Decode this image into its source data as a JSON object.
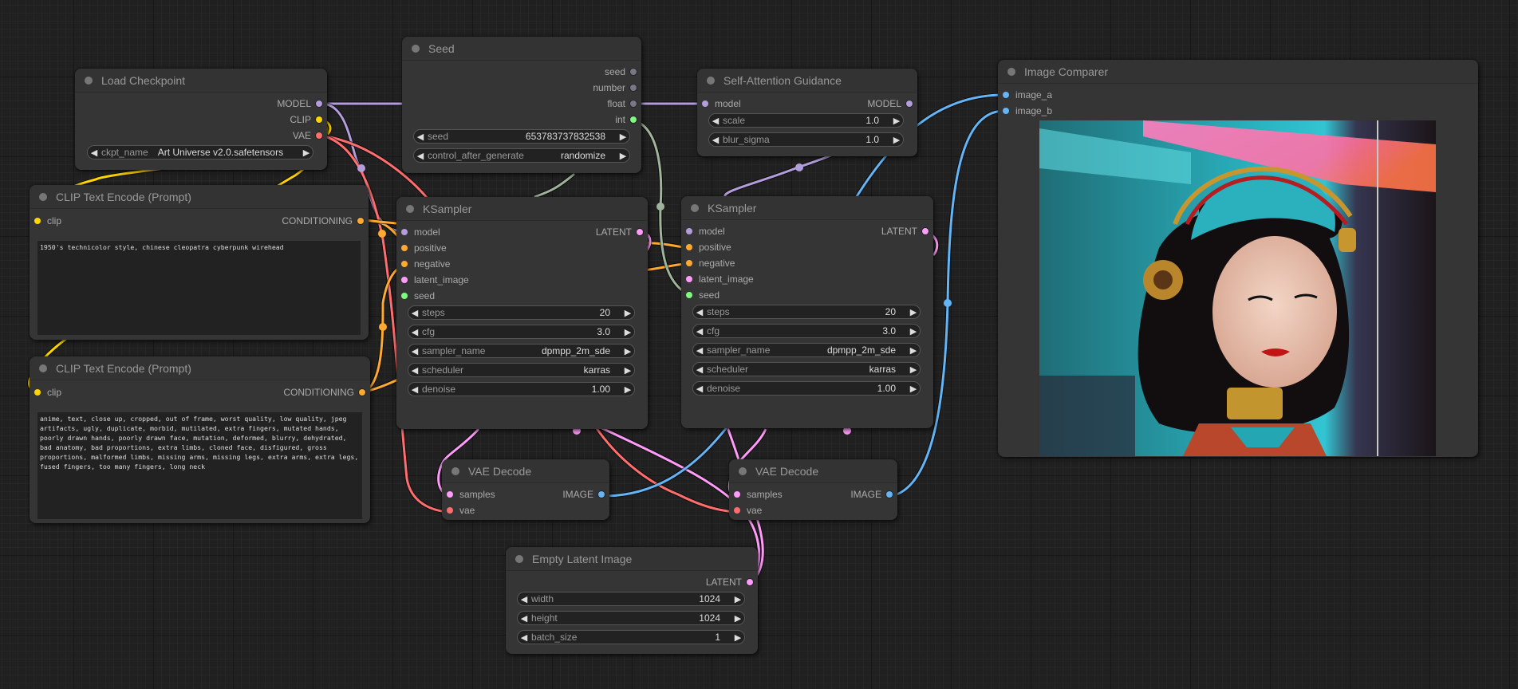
{
  "colors": {
    "MODEL": "#b39ddb",
    "CLIP": "#ffd500",
    "VAE": "#ff6e6e",
    "CONDITIONING": "#ffa931",
    "LATENT": "#ff9cf9",
    "IMAGE": "#64b5f6",
    "INT": "#7ffa7f",
    "INT_WIRE": "#a0b39b",
    "generic": "#778"
  },
  "nodes": {
    "load_checkpoint": {
      "title": "Load Checkpoint",
      "outputs": [
        "MODEL",
        "CLIP",
        "VAE"
      ],
      "widgets": [
        {
          "label": "ckpt_name",
          "value": "Art Universe v2.0.safetensors"
        }
      ]
    },
    "seed": {
      "title": "Seed",
      "outputs": [
        "seed",
        "number",
        "float",
        "int"
      ],
      "widgets": [
        {
          "label": "seed",
          "value": "653783737832538"
        },
        {
          "label": "control_after_generate",
          "value": "randomize"
        }
      ]
    },
    "sag": {
      "title": "Self-Attention Guidance",
      "inputs": [
        "model"
      ],
      "outputs": [
        "MODEL"
      ],
      "widgets": [
        {
          "label": "scale",
          "value": "1.0"
        },
        {
          "label": "blur_sigma",
          "value": "1.0"
        }
      ]
    },
    "clip_pos": {
      "title": "CLIP Text Encode (Prompt)",
      "inputs": [
        "clip"
      ],
      "outputs": [
        "CONDITIONING"
      ],
      "text": "1950's technicolor style, chinese cleopatra cyberpunk wirehead"
    },
    "clip_neg": {
      "title": "CLIP Text Encode (Prompt)",
      "inputs": [
        "clip"
      ],
      "outputs": [
        "CONDITIONING"
      ],
      "text": "anime, text, close up, cropped, out of frame, worst quality, low quality, jpeg artifacts, ugly, duplicate, morbid, mutilated, extra fingers, mutated hands, poorly drawn hands, poorly drawn face, mutation, deformed, blurry, dehydrated, bad anatomy, bad proportions, extra limbs, cloned face, disfigured, gross proportions, malformed limbs, missing arms, missing legs, extra arms, extra legs, fused fingers, too many fingers, long neck"
    },
    "ksampler_1": {
      "title": "KSampler",
      "inputs": [
        "model",
        "positive",
        "negative",
        "latent_image",
        "seed"
      ],
      "outputs": [
        "LATENT"
      ],
      "widgets": [
        {
          "label": "steps",
          "value": "20"
        },
        {
          "label": "cfg",
          "value": "3.0"
        },
        {
          "label": "sampler_name",
          "value": "dpmpp_2m_sde"
        },
        {
          "label": "scheduler",
          "value": "karras"
        },
        {
          "label": "denoise",
          "value": "1.00"
        }
      ]
    },
    "ksampler_2": {
      "title": "KSampler",
      "inputs": [
        "model",
        "positive",
        "negative",
        "latent_image",
        "seed"
      ],
      "outputs": [
        "LATENT"
      ],
      "widgets": [
        {
          "label": "steps",
          "value": "20"
        },
        {
          "label": "cfg",
          "value": "3.0"
        },
        {
          "label": "sampler_name",
          "value": "dpmpp_2m_sde"
        },
        {
          "label": "scheduler",
          "value": "karras"
        },
        {
          "label": "denoise",
          "value": "1.00"
        }
      ]
    },
    "vae_decode_1": {
      "title": "VAE Decode",
      "inputs": [
        "samples",
        "vae"
      ],
      "outputs": [
        "IMAGE"
      ]
    },
    "vae_decode_2": {
      "title": "VAE Decode",
      "inputs": [
        "samples",
        "vae"
      ],
      "outputs": [
        "IMAGE"
      ]
    },
    "empty_latent": {
      "title": "Empty Latent Image",
      "outputs": [
        "LATENT"
      ],
      "widgets": [
        {
          "label": "width",
          "value": "1024"
        },
        {
          "label": "height",
          "value": "1024"
        },
        {
          "label": "batch_size",
          "value": "1"
        }
      ]
    },
    "image_comparer": {
      "title": "Image Comparer",
      "inputs": [
        "image_a",
        "image_b"
      ],
      "image_description": "Generated portrait: woman with black bob hair, teal and gold cyberpunk headgear with headphones, red lips, gold collar, neon pink and teal background",
      "slider_position": 0.85
    }
  },
  "icons": {
    "arrow_left": "◀",
    "arrow_right": "▶"
  }
}
